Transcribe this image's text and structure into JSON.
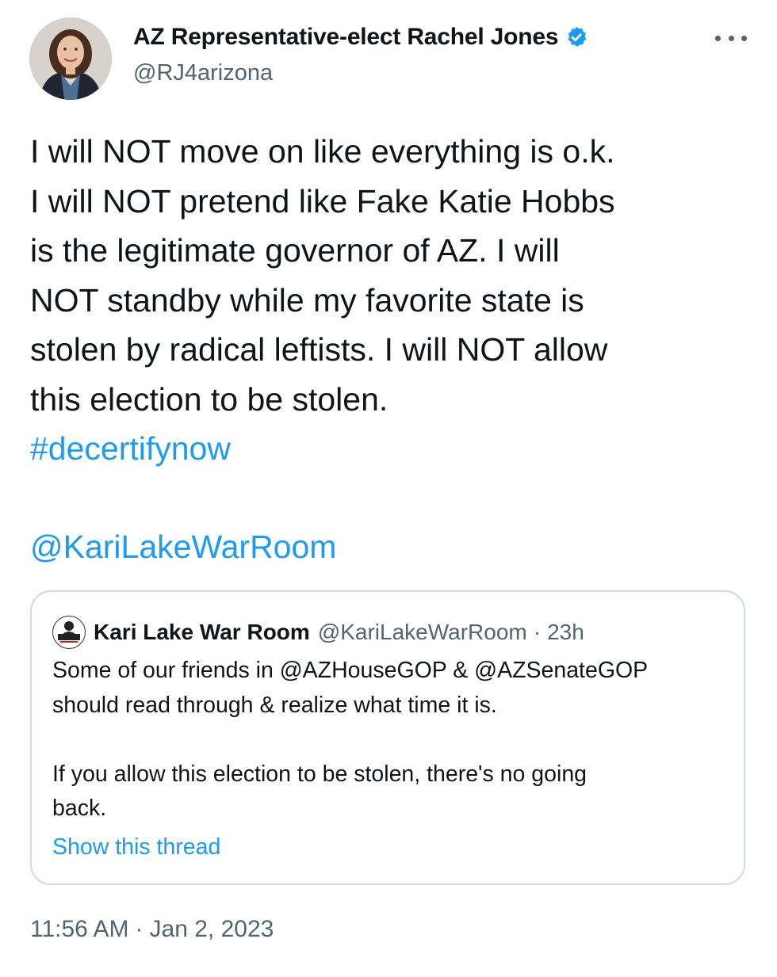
{
  "author": {
    "display_name": "AZ Representative-elect Rachel Jones",
    "handle": "@RJ4arizona",
    "verified": true
  },
  "tweet": {
    "lines": [
      "I will NOT move on like everything is o.k.",
      "I will NOT pretend like Fake Katie Hobbs",
      "is the legitimate governor of AZ. I will",
      "NOT standby while my favorite state is",
      "stolen by radical leftists. I will NOT allow",
      "this election to be stolen."
    ],
    "hashtag": "#decertifynow",
    "mention": "@KariLakeWarRoom"
  },
  "quote": {
    "name": "Kari Lake War Room",
    "handle": "@KariLakeWarRoom",
    "separator": "·",
    "time": "23h",
    "body_lines": [
      "Some of our friends in @AZHouseGOP & @AZSenateGOP",
      "should read through & realize what time it is."
    ],
    "body_lines_2": [
      "If you allow this election to be stolen, there's no going",
      "back."
    ],
    "show_thread": "Show this thread"
  },
  "meta": {
    "time": "11:56 AM",
    "separator": "·",
    "date": "Jan 2, 2023"
  },
  "colors": {
    "link": "#1d9bf0",
    "secondary_text": "#536471",
    "border": "#cfd9de",
    "verified": "#1d9bf0"
  },
  "icons": {
    "verified": "verified-badge-icon",
    "more": "more-options-icon"
  }
}
